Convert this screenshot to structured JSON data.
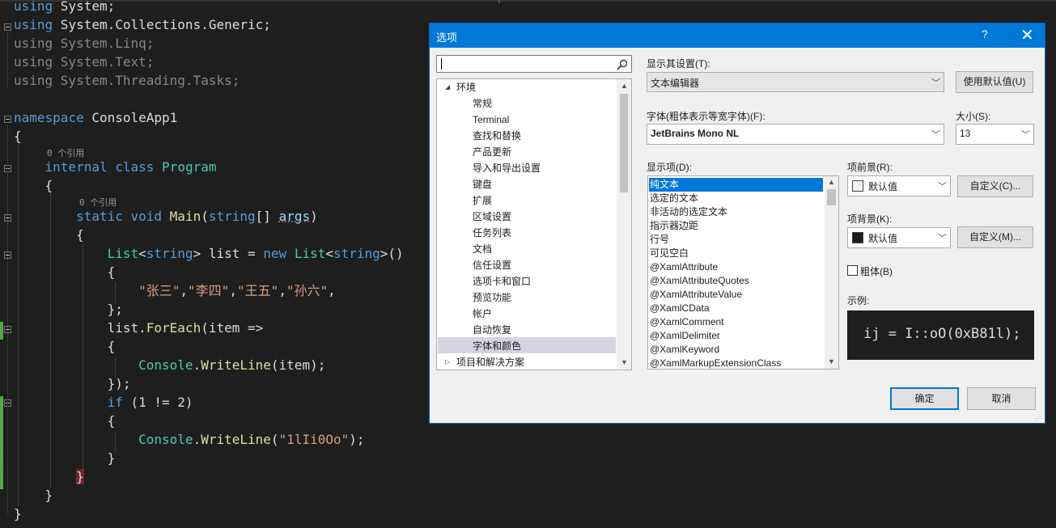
{
  "editor": {
    "lines": [
      {
        "tokens": [
          {
            "t": "using",
            "c": "kw"
          },
          {
            "t": " System;"
          }
        ]
      },
      {
        "tokens": [
          {
            "t": "using",
            "c": "kw"
          },
          {
            "t": " System.Collections.Generic;"
          }
        ]
      },
      {
        "tokens": [
          {
            "t": "using System.Linq;",
            "c": "dim"
          }
        ]
      },
      {
        "tokens": [
          {
            "t": "using System.Text;",
            "c": "dim"
          }
        ]
      },
      {
        "tokens": [
          {
            "t": "using System.Threading.Tasks;",
            "c": "dim"
          }
        ]
      },
      {
        "tokens": [
          {
            "t": "namespace",
            "c": "kw"
          },
          {
            "t": " ConsoleApp1"
          }
        ]
      },
      {
        "tokens": [
          {
            "t": "{"
          }
        ]
      },
      {
        "tokens": [
          {
            "t": "    "
          },
          {
            "t": "internal",
            "c": "kw"
          },
          {
            "t": " "
          },
          {
            "t": "class",
            "c": "kw"
          },
          {
            "t": " "
          },
          {
            "t": "Program",
            "c": "ty"
          }
        ]
      },
      {
        "tokens": [
          {
            "t": "    {"
          }
        ]
      },
      {
        "tokens": [
          {
            "t": "        "
          },
          {
            "t": "static",
            "c": "kw"
          },
          {
            "t": " "
          },
          {
            "t": "void",
            "c": "kw"
          },
          {
            "t": " "
          },
          {
            "t": "Main",
            "c": "fn"
          },
          {
            "t": "("
          },
          {
            "t": "string",
            "c": "kw"
          },
          {
            "t": "[] "
          },
          {
            "t": "args",
            "c": "pa"
          },
          {
            "t": ")"
          }
        ]
      },
      {
        "tokens": [
          {
            "t": "        {"
          }
        ]
      },
      {
        "tokens": [
          {
            "t": "            "
          },
          {
            "t": "List",
            "c": "ty"
          },
          {
            "t": "<"
          },
          {
            "t": "string",
            "c": "kw"
          },
          {
            "t": "> list = "
          },
          {
            "t": "new",
            "c": "kw"
          },
          {
            "t": " "
          },
          {
            "t": "List",
            "c": "ty"
          },
          {
            "t": "<"
          },
          {
            "t": "string",
            "c": "kw"
          },
          {
            "t": ">()"
          }
        ]
      },
      {
        "tokens": [
          {
            "t": "            {"
          }
        ]
      },
      {
        "tokens": [
          {
            "t": "                "
          },
          {
            "t": "\"张三\"",
            "c": "st"
          },
          {
            "t": ","
          },
          {
            "t": "\"李四\"",
            "c": "st"
          },
          {
            "t": ","
          },
          {
            "t": "\"王五\"",
            "c": "st"
          },
          {
            "t": ","
          },
          {
            "t": "\"孙六\"",
            "c": "st"
          },
          {
            "t": ","
          }
        ]
      },
      {
        "tokens": [
          {
            "t": "            };"
          }
        ]
      },
      {
        "tokens": [
          {
            "t": "            list."
          },
          {
            "t": "ForEach",
            "c": "fn"
          },
          {
            "t": "(item =>"
          }
        ]
      },
      {
        "tokens": [
          {
            "t": "            {"
          }
        ]
      },
      {
        "tokens": [
          {
            "t": "                "
          },
          {
            "t": "Console",
            "c": "ty"
          },
          {
            "t": "."
          },
          {
            "t": "WriteLine",
            "c": "fn"
          },
          {
            "t": "(item);"
          }
        ]
      },
      {
        "tokens": [
          {
            "t": "            });"
          }
        ]
      },
      {
        "tokens": [
          {
            "t": "            "
          },
          {
            "t": "if",
            "c": "kw"
          },
          {
            "t": " (1 != 2)"
          }
        ]
      },
      {
        "tokens": [
          {
            "t": "            {"
          }
        ]
      },
      {
        "tokens": [
          {
            "t": "                "
          },
          {
            "t": "Console",
            "c": "ty"
          },
          {
            "t": "."
          },
          {
            "t": "WriteLine",
            "c": "fn"
          },
          {
            "t": "("
          },
          {
            "t": "\"1lIi0Oo\"",
            "c": "st"
          },
          {
            "t": ");"
          }
        ]
      },
      {
        "tokens": [
          {
            "t": "            }"
          }
        ]
      },
      {
        "tokens": [
          {
            "t": "        "
          },
          {
            "t": "}",
            "c": "brace-hl"
          }
        ]
      },
      {
        "tokens": [
          {
            "t": "    }"
          }
        ]
      },
      {
        "tokens": [
          {
            "t": "}"
          }
        ]
      }
    ],
    "codelens_class": "0 个引用",
    "codelens_method": "0 个引用"
  },
  "dialog": {
    "title": "选项",
    "help": "?",
    "close": "✕",
    "search_value": "",
    "tree_items": [
      {
        "label": "环境",
        "expander": "◢",
        "level": 0
      },
      {
        "label": "常规",
        "level": 1
      },
      {
        "label": "Terminal",
        "level": 1
      },
      {
        "label": "查找和替换",
        "level": 1
      },
      {
        "label": "产品更新",
        "level": 1
      },
      {
        "label": "导入和导出设置",
        "level": 1
      },
      {
        "label": "键盘",
        "level": 1
      },
      {
        "label": "扩展",
        "level": 1
      },
      {
        "label": "区域设置",
        "level": 1
      },
      {
        "label": "任务列表",
        "level": 1
      },
      {
        "label": "文档",
        "level": 1
      },
      {
        "label": "信任设置",
        "level": 1
      },
      {
        "label": "选项卡和窗口",
        "level": 1
      },
      {
        "label": "预览功能",
        "level": 1
      },
      {
        "label": "帐户",
        "level": 1
      },
      {
        "label": "自动恢复",
        "level": 1
      },
      {
        "label": "字体和颜色",
        "level": 1,
        "selected": true
      },
      {
        "label": "项目和解决方案",
        "expander": "▷",
        "level": 0
      }
    ],
    "show_settings_label": "显示其设置(T):",
    "show_settings_value": "文本编辑器",
    "use_defaults_button": "使用默认值(U)",
    "font_label": "字体(粗体表示等宽字体)(F):",
    "font_value": "JetBrains Mono NL",
    "size_label": "大小(S):",
    "size_value": "13",
    "display_items_label": "显示项(D):",
    "display_items": [
      "纯文本",
      "选定的文本",
      "非活动的选定文本",
      "指示器边距",
      "行号",
      "可见空白",
      "@XamlAttribute",
      "@XamlAttributeQuotes",
      "@XamlAttributeValue",
      "@XamlCData",
      "@XamlComment",
      "@XamlDelimiter",
      "@XamlKeyword",
      "@XamlMarkupExtensionClass"
    ],
    "foreground_label": "项前景(R):",
    "foreground_value": "默认值",
    "foreground_color": "#f0f0f0",
    "custom_fg_button": "自定义(C)...",
    "background_label": "项背景(K):",
    "background_value": "默认值",
    "background_color": "#1e1e1e",
    "custom_bg_button": "自定义(M)...",
    "bold_label": "粗体(B)",
    "sample_label": "示例:",
    "sample_text": "ij = I::oO(0xB81l);",
    "ok_button": "确定",
    "cancel_button": "取消"
  },
  "colors": {
    "accent": "#0078d7",
    "editor_bg": "#1e1e1e",
    "keyword": "#569cd6",
    "type": "#4ec9b0",
    "string": "#d69d85",
    "method": "#dcdcaa"
  }
}
